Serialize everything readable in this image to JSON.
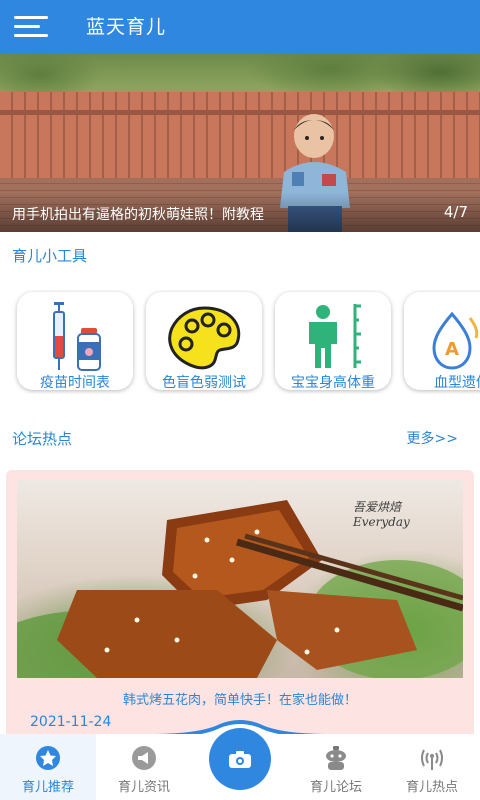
{
  "header": {
    "title": "蓝天育儿",
    "menu_icon": "hamburger-menu-icon"
  },
  "banner": {
    "caption": "用手机拍出有逼格的初秋萌娃照！附教程",
    "page_indicator": "4/7"
  },
  "tools": {
    "title": "育儿小工具",
    "items": [
      {
        "label": "疫苗时间表",
        "icon": "vaccine-syringe-icon"
      },
      {
        "label": "色盲色弱测试",
        "icon": "color-palette-icon"
      },
      {
        "label": "宝宝身高体重",
        "icon": "height-ruler-icon"
      },
      {
        "label": "血型遗传",
        "icon": "blood-drop-icon"
      }
    ]
  },
  "forum": {
    "title": "论坛热点",
    "more": "更多>>",
    "post": {
      "headline": "韩式烤五花肉，简单快手！在家也能做！",
      "date": "2021-11-24",
      "watermark": "吾爱烘焙 Everyday"
    }
  },
  "bottom_nav": {
    "items": [
      {
        "label": "育儿推荐",
        "icon": "recommend-star-icon",
        "active": true
      },
      {
        "label": "育儿资讯",
        "icon": "megaphone-icon",
        "active": false
      },
      {
        "label": "育儿论坛",
        "icon": "forum-robot-icon",
        "active": false
      },
      {
        "label": "育儿热点",
        "icon": "broadcast-antenna-icon",
        "active": false
      }
    ],
    "center_action_icon": "camera-icon"
  },
  "colors": {
    "primary": "#2f87e0",
    "accent_text": "#2a86d8",
    "forum_card_bg": "#fde3e1"
  }
}
